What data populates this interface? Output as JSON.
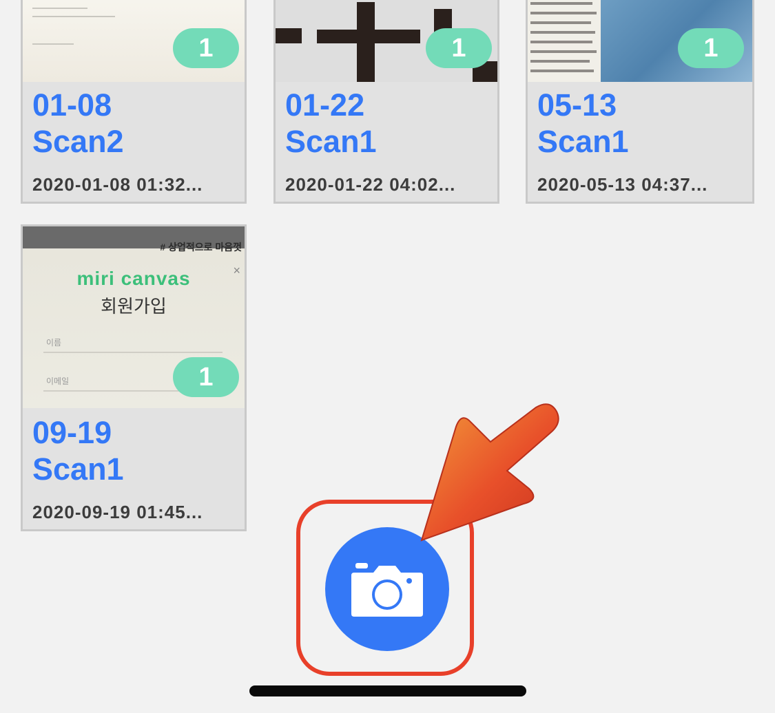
{
  "scans": [
    {
      "date_label": "01-08",
      "scan_name": "Scan2",
      "timestamp": "2020-01-08 01:32...",
      "page_count": "1",
      "thumbnail": "document-text"
    },
    {
      "date_label": "01-22",
      "scan_name": "Scan1",
      "timestamp": "2020-01-22 04:02...",
      "page_count": "1",
      "thumbnail": "large-glyph"
    },
    {
      "date_label": "05-13",
      "scan_name": "Scan1",
      "timestamp": "2020-05-13 04:37...",
      "page_count": "1",
      "thumbnail": "newspaper-photo"
    },
    {
      "date_label": "09-19",
      "scan_name": "Scan1",
      "timestamp": "2020-09-19 01:45...",
      "page_count": "1",
      "thumbnail": "signup-screen",
      "thumb_text": {
        "banner": "# 상업적으로 마음껏",
        "logo": "miri canvas",
        "title": "회원가입",
        "field_name": "이름",
        "field_email": "이메일"
      }
    }
  ],
  "camera_button": {
    "icon": "camera-icon",
    "color": "#3478f6"
  },
  "annotation": {
    "highlight_color": "#e8402a",
    "arrow_color": "#e8502a"
  },
  "colors": {
    "accent": "#3478f6",
    "badge": "#73dbb8",
    "background": "#f2f2f2",
    "card": "#e2e2e2"
  }
}
